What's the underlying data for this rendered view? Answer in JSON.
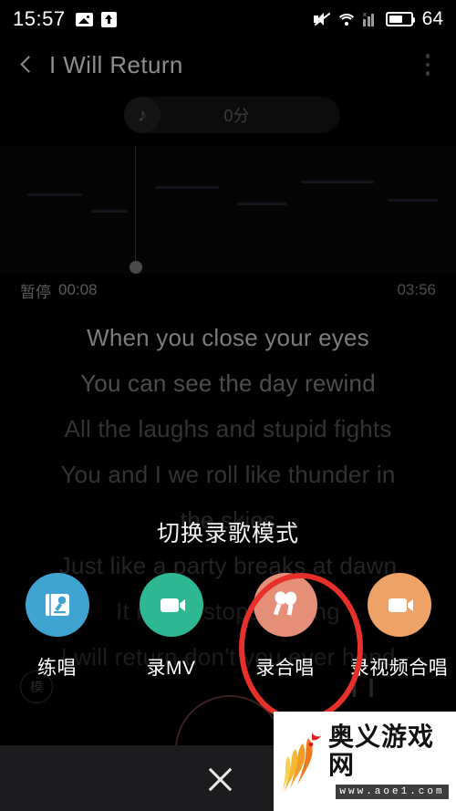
{
  "status_bar": {
    "time": "15:57",
    "battery_level": "64",
    "left_icons": [
      "photo-icon",
      "upload-icon"
    ],
    "right_icons": [
      "mute-icon",
      "wifi-icon",
      "signal-icon",
      "battery-icon"
    ]
  },
  "title_bar": {
    "back_icon": "chevron-left-icon",
    "song_title": "I Will Return",
    "more_icon": "more-vertical-icon"
  },
  "score": {
    "badge_icon": "music-note-icon",
    "value": "0分"
  },
  "playback": {
    "status": "暂停",
    "current_time": "00:08",
    "total_time": "03:56"
  },
  "lyrics": [
    {
      "text": "When you close your eyes",
      "state": "active"
    },
    {
      "text": "You can see the day rewind",
      "state": "near"
    },
    {
      "text": "All the laughs and stupid fights",
      "state": "dim"
    },
    {
      "text": "You and I we roll like thunder in",
      "state": "dim"
    },
    {
      "text": "the skies",
      "state": "faint"
    },
    {
      "text": "Just like a party breaks at dawn",
      "state": "faint"
    },
    {
      "text": "It never stops ringing",
      "state": "ghost"
    },
    {
      "text": "I will return don't you ever hand",
      "state": "ghost"
    }
  ],
  "background_controls": {
    "mode_button_label": "模",
    "pause_icon": "pause-icon",
    "record_button": "record-button"
  },
  "mode_overlay": {
    "title": "切换录歌模式",
    "modes": [
      {
        "label": "练唱",
        "icon": "mic-card-icon",
        "color": "#3FA4D2",
        "selected": false
      },
      {
        "label": "录MV",
        "icon": "video-camera-icon",
        "color": "#2EB793",
        "selected": false
      },
      {
        "label": "录合唱",
        "icon": "duet-mic-icon",
        "color": "#E58E78",
        "selected": true
      },
      {
        "label": "录视频合唱",
        "icon": "video-camera-icon",
        "color": "#EFA濃65",
        "selected": false
      }
    ],
    "close_icon": "close-icon"
  },
  "annotation": {
    "shape": "ellipse",
    "color": "#E8302A",
    "targets": "录合唱"
  },
  "watermark": {
    "logo_icon": "phoenix-logo-icon",
    "title": "奥义游戏网",
    "url": "www.aoe1.com"
  }
}
